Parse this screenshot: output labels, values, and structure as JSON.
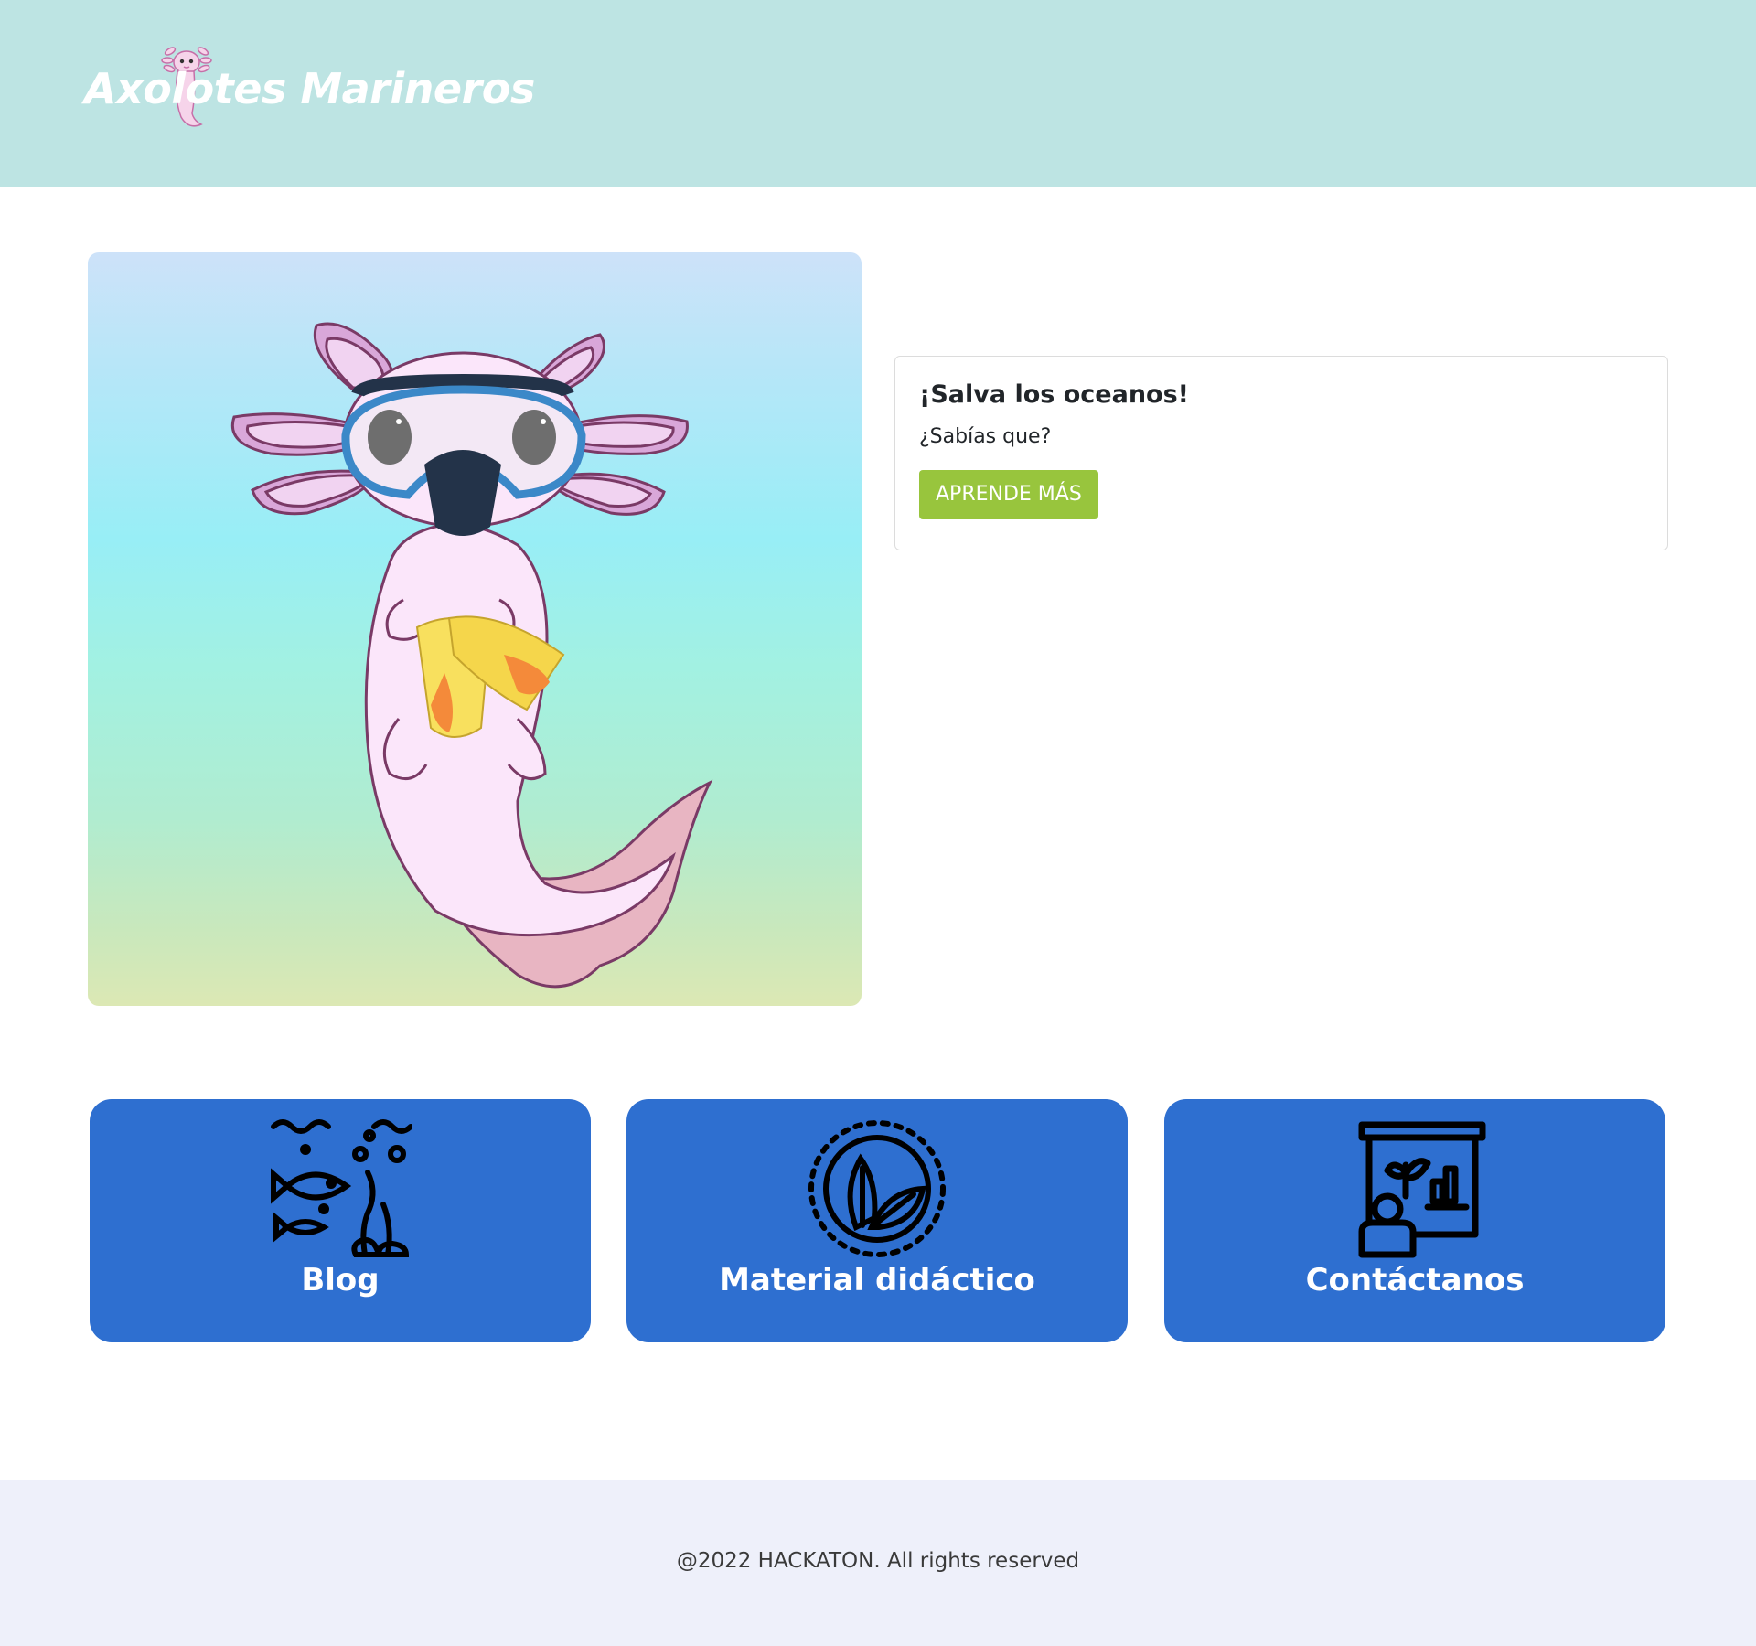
{
  "header": {
    "brand_name": "Axolotes Marineros"
  },
  "hero": {
    "illustration": "axolotl-snorkeling-illustration"
  },
  "card": {
    "title": "¡Salva los oceanos!",
    "text": "¿Sabías que?",
    "button_label": "APRENDE MÁS"
  },
  "tiles": [
    {
      "label": "Blog",
      "icon": "ocean-life-icon"
    },
    {
      "label": "Material didáctico",
      "icon": "leaf-circle-icon"
    },
    {
      "label": "Contáctanos",
      "icon": "presentation-board-icon"
    }
  ],
  "footer": {
    "text": "@2022 HACKATON. All rights reserved"
  },
  "colors": {
    "header_bg": "#bde4e3",
    "tile_bg": "#2e6fd0",
    "button_bg": "#98c53d",
    "footer_bg": "#eef0fa"
  }
}
